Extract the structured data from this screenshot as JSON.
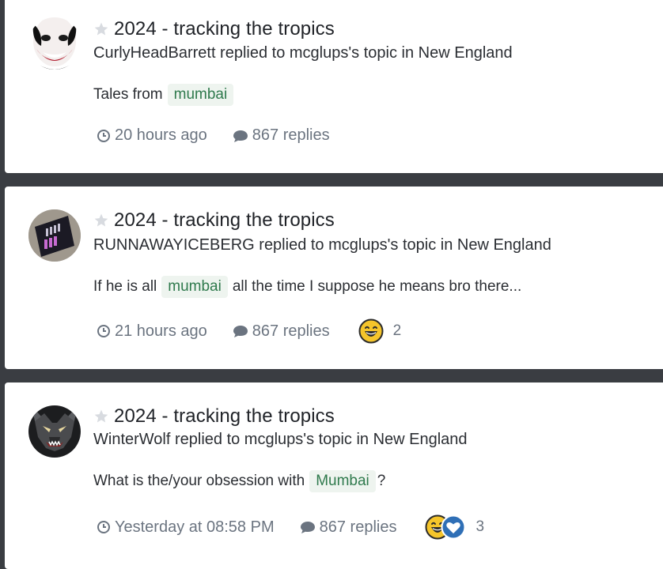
{
  "activity": [
    {
      "avatar": "joker-face-avatar",
      "title": "2024 - tracking the tropics",
      "meta": "CurlyHeadBarrett replied to mcglups's topic in New England",
      "snippet_before": "Tales from",
      "tag": "mumbai",
      "snippet_after": "",
      "time": "20 hours ago",
      "replies": "867 replies",
      "reaction_count": ""
    },
    {
      "avatar": "protest-sign-avatar",
      "title": "2024 - tracking the tropics",
      "meta": "RUNNAWAYICEBERG replied to mcglups's topic in New England",
      "snippet_before": "If he is all",
      "tag": "mumbai",
      "snippet_after": "all the time I suppose he means bro there...",
      "time": "21 hours ago",
      "replies": "867 replies",
      "reaction_count": "2"
    },
    {
      "avatar": "wolf-avatar",
      "title": "2024 - tracking the tropics",
      "meta": "WinterWolf replied to mcglups's topic in New England",
      "snippet_before": "What is the/your obsession with",
      "tag": "Mumbai",
      "snippet_after": "?",
      "time": "Yesterday at 08:58 PM",
      "replies": "867 replies",
      "reaction_count": "3"
    }
  ],
  "colors": {
    "background": "#3a3d42",
    "tag_bg": "#eef4ef",
    "tag_text": "#2f7a4d",
    "muted": "#6b7480",
    "heart_blue": "#2f6fb6",
    "emoji_yellow": "#f5c52b"
  }
}
